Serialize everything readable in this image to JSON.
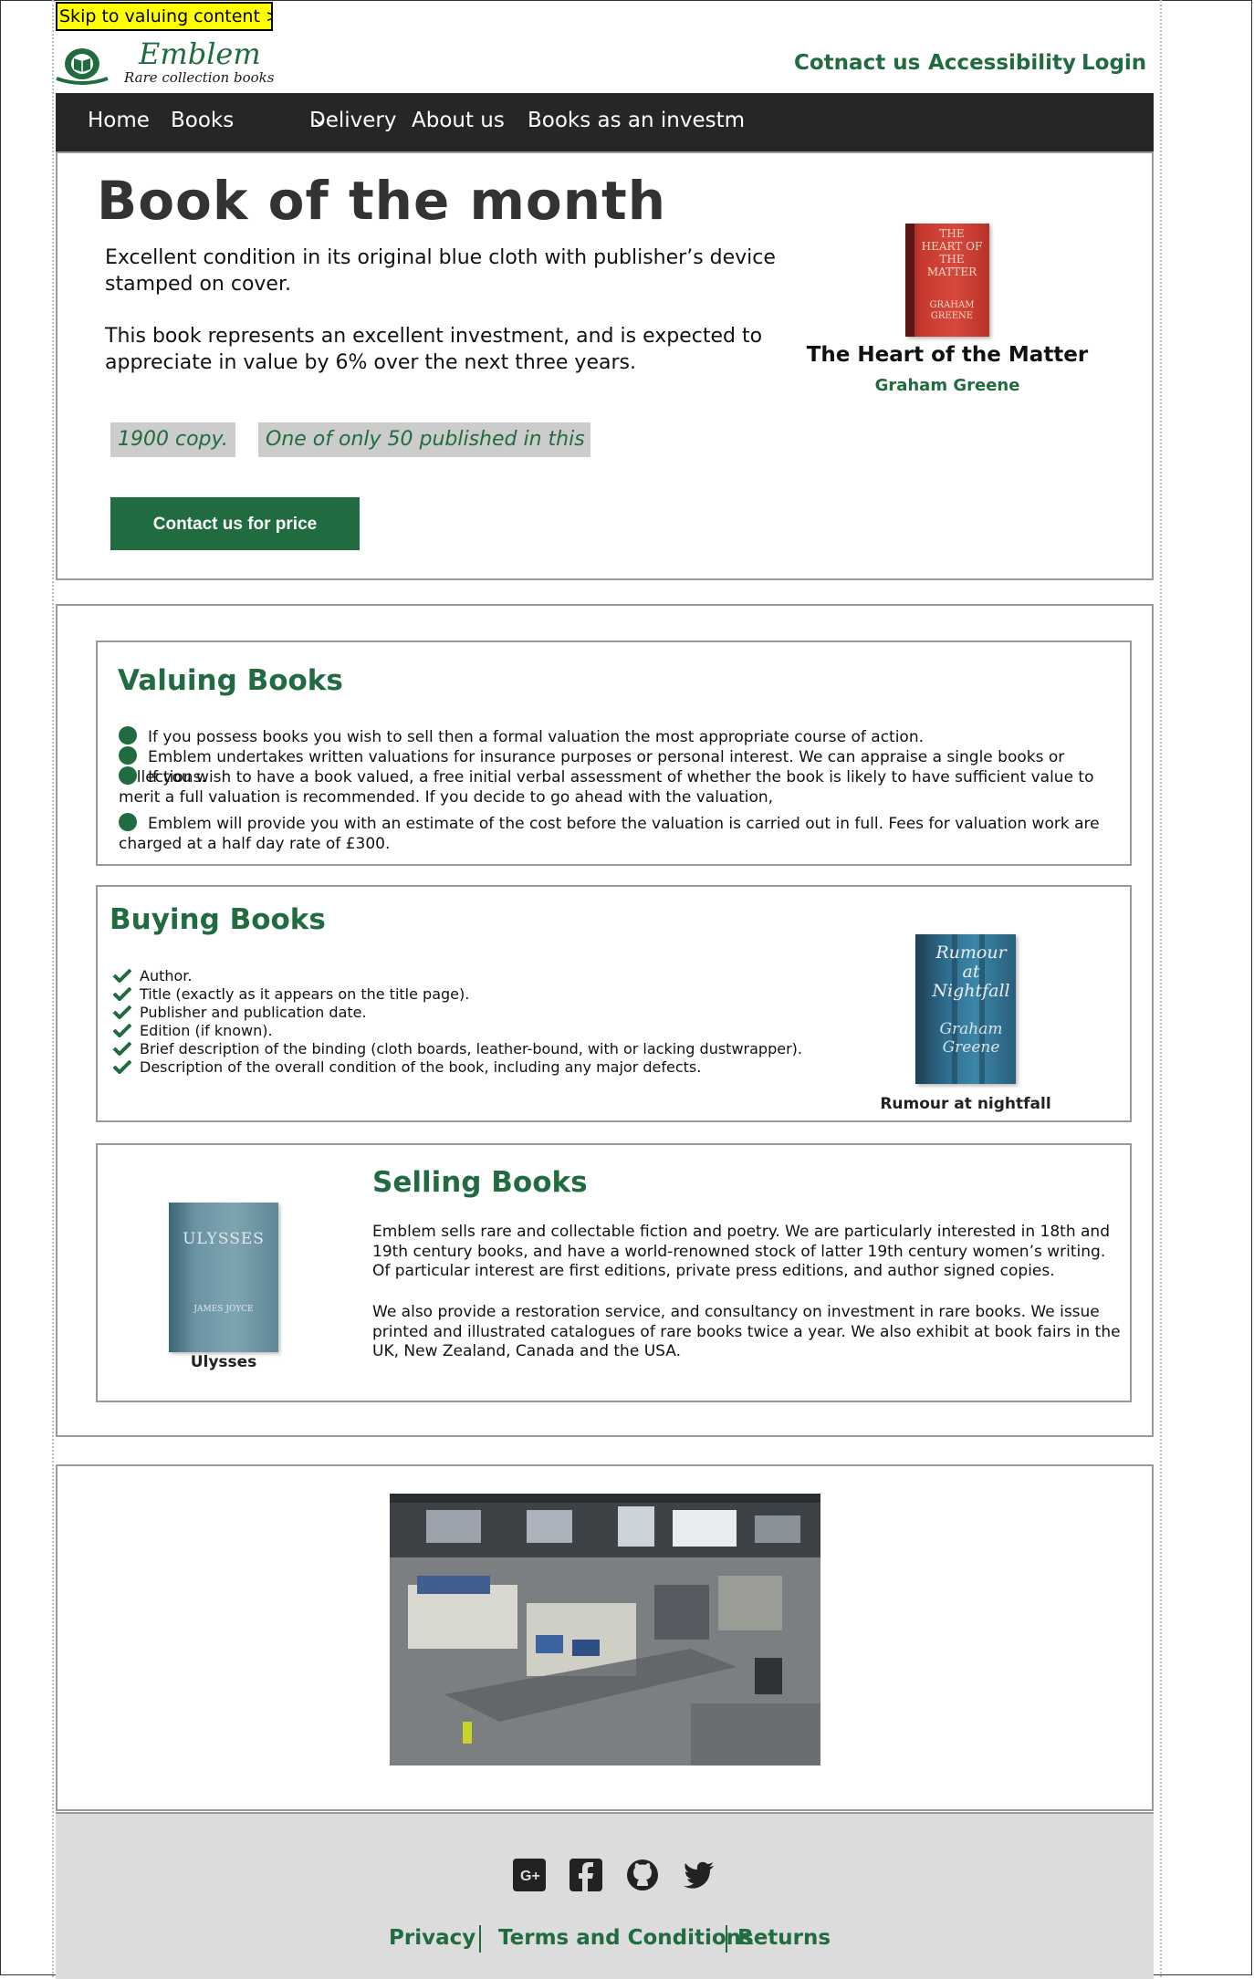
{
  "skip_link": "Skip to valuing content >>",
  "brand": {
    "name": "Emblem",
    "tagline": "Rare collection books"
  },
  "top_links": [
    "Cotnact us",
    "Accessibility",
    "Login"
  ],
  "nav": {
    "items": [
      "Home",
      "Books",
      "Delivery",
      "About us",
      "Books as an investm"
    ]
  },
  "book_of_month": {
    "title": "Book of the month",
    "para1": "Excellent condition in its original blue cloth with publisher’s device stamped on cover.",
    "para2": "This book represents an excellent investment, and is expected to appreciate in value by 6% over the next three years.",
    "tags": [
      "1900 copy.",
      "One of only 50 published in this"
    ],
    "button": "Contact us for price",
    "book_title": "The Heart of the Matter",
    "book_author": "Graham Greene",
    "cover_title": "THE HEART OF THE MATTER",
    "cover_author": "GRAHAM GREENE"
  },
  "valuing": {
    "heading": "Valuing Books",
    "items": [
      "If you possess books you wish to sell then a formal valuation the most appropriate course of action.",
      "Emblem undertakes written valuations for insurance purposes or personal interest. We can appraise a single books or collections.",
      "If you wish to have a book valued, a free initial verbal assessment of whether the book is likely to have sufficient value to merit a full valuation is recommended. If you decide to go ahead with the valuation,",
      "Emblem will provide you with an estimate of the cost before the valuation is carried out in full. Fees for valuation work are charged at a half day rate of £300."
    ]
  },
  "buying": {
    "heading": "Buying Books",
    "items": [
      "Author.",
      "Title (exactly as it appears on the title page).",
      "Publisher and publication date.",
      "Edition (if known).",
      "Brief description of the binding (cloth boards, leather-bound, with or lacking dustwrapper).",
      "Description of the overall condition of the book,  including any major defects."
    ],
    "image_caption": "Rumour at nightfall",
    "cover_title": "Rumour at Nightfall",
    "cover_author": "Graham Greene"
  },
  "selling": {
    "heading": "Selling Books",
    "para1": "Emblem sells rare and collectable fiction and poetry. We are particularly interested in 18th and 19th century books, and have a world-renowned stock of latter 19th century women’s writing. Of particular interest are first editions, private press editions, and author signed copies.",
    "para2": "We also provide a restoration service, and consultancy on investment in rare books. We issue printed and illustrated catalogues of rare books twice a year. We also exhibit at book fairs in the UK, New Zealand, Canada and the USA.",
    "image_caption": "Ulysses",
    "cover_title": "ULYSSES",
    "cover_author": "JAMES JOYCE"
  },
  "footer": {
    "social": [
      "google-plus-icon",
      "facebook-icon",
      "github-icon",
      "twitter-icon"
    ],
    "links": [
      "Privacy",
      "Terms and Conditions",
      "Returns"
    ]
  },
  "colors": {
    "brand_green": "#206b40",
    "nav_bg": "#262626",
    "footer_bg": "#dcdcdc",
    "skip_bg": "#ffff00"
  }
}
